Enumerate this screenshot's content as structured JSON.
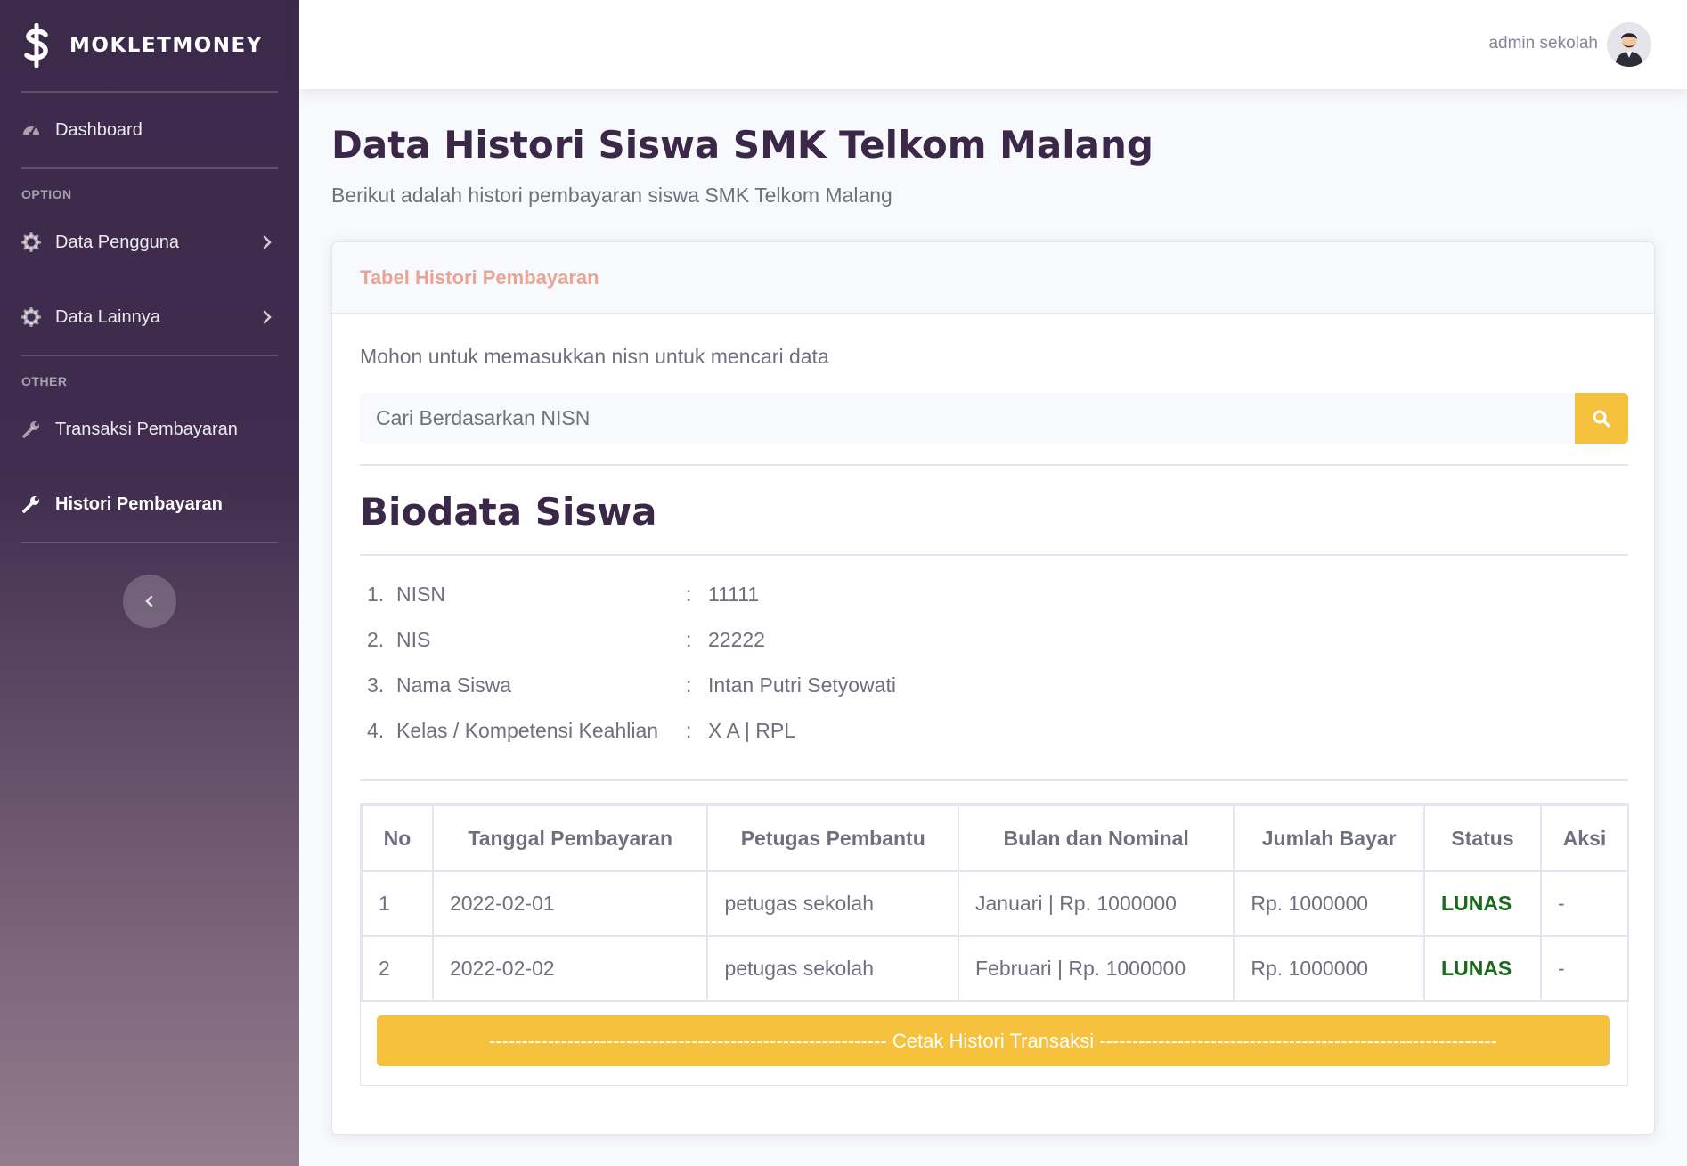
{
  "sidebar": {
    "brand": "MOKLETMONEY",
    "dashboard": "Dashboard",
    "heading_option": "OPTION",
    "data_pengguna": "Data Pengguna",
    "data_lainnya": "Data Lainnya",
    "heading_other": "OTHER",
    "transaksi": "Transaksi Pembayaran",
    "histori": "Histori Pembayaran"
  },
  "topbar": {
    "user_name": "admin sekolah"
  },
  "page": {
    "title": "Data Histori Siswa SMK Telkom Malang",
    "subtitle": "Berikut adalah histori pembayaran siswa SMK Telkom Malang"
  },
  "card": {
    "title": "Tabel Histori Pembayaran",
    "hint": "Mohon untuk memasukkan nisn untuk mencari data",
    "search_placeholder": "Cari Berdasarkan NISN",
    "section_title": "Biodata Siswa"
  },
  "biodata": [
    {
      "num": "1.",
      "label": "NISN",
      "value": "11111"
    },
    {
      "num": "2.",
      "label": "NIS",
      "value": "22222"
    },
    {
      "num": "3.",
      "label": "Nama Siswa",
      "value": "Intan Putri Setyowati"
    },
    {
      "num": "4.",
      "label": "Kelas / Kompetensi Keahlian",
      "value": "X A | RPL"
    }
  ],
  "table": {
    "headers": [
      "No",
      "Tanggal Pembayaran",
      "Petugas Pembantu",
      "Bulan dan Nominal",
      "Jumlah Bayar",
      "Status",
      "Aksi"
    ],
    "rows": [
      [
        "1",
        "2022-02-01",
        "petugas sekolah",
        "Januari | Rp. 1000000",
        "Rp. 1000000",
        "LUNAS",
        "-"
      ],
      [
        "2",
        "2022-02-02",
        "petugas sekolah",
        "Februari | Rp. 1000000",
        "Rp. 1000000",
        "LUNAS",
        "-"
      ]
    ]
  },
  "print_button": "------------------------------------------------------------- Cetak Histori Transaksi -------------------------------------------------------------",
  "colors": {
    "accent": "#f6c23e",
    "sidebar_top": "#3c2a4b",
    "title": "#3b2748",
    "card_title": "#e8a594",
    "status_lunas": "#1a6b1a"
  }
}
